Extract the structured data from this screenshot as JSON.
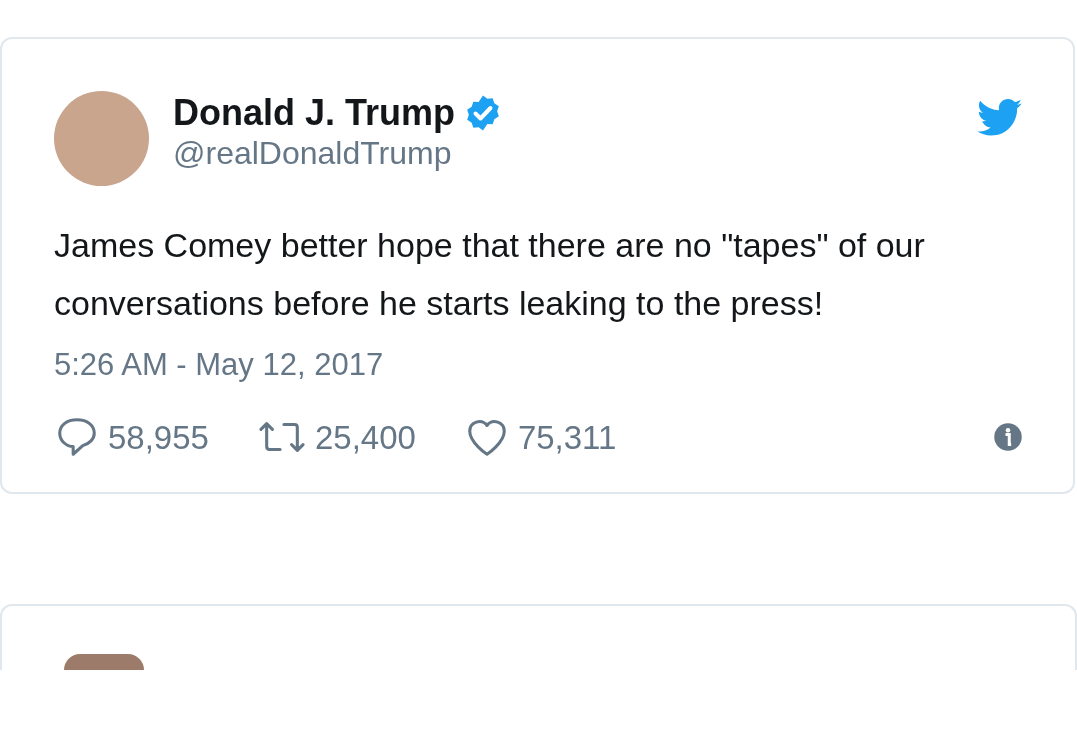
{
  "tweet": {
    "author": {
      "name": "Donald J. Trump",
      "handle": "@realDonaldTrump",
      "verified": true
    },
    "text": "James Comey better hope that there are no \"tapes\" of our conversations before he starts leaking to the press!",
    "timestamp": "5:26 AM - May 12, 2017",
    "actions": [
      {
        "kind": "reply",
        "count": "58,955"
      },
      {
        "kind": "retweet",
        "count": "25,400"
      },
      {
        "kind": "like",
        "count": "75,311"
      }
    ]
  },
  "more_tweets_below": true
}
